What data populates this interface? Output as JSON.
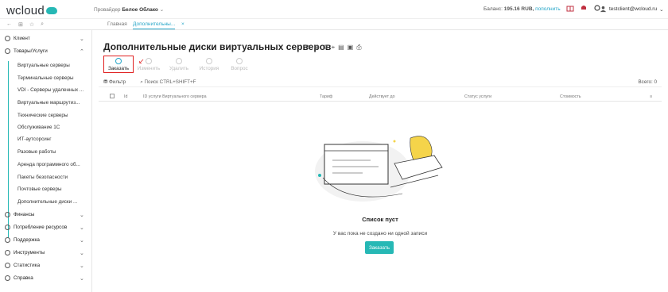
{
  "header": {
    "logo": "wcloud",
    "provider_label": "Провайдер",
    "provider_name": "Белое Облако",
    "balance_label": "Баланс:",
    "balance_value": "195.16 RUB,",
    "balance_link": "пополнить",
    "user": "testclient@wcloud.ru"
  },
  "tabs": [
    {
      "label": "Главная"
    },
    {
      "label": "Дополнительны..."
    }
  ],
  "sidebar": {
    "groups": [
      {
        "label": "Клиент"
      },
      {
        "label": "Товары/Услуги"
      },
      {
        "label": "Финансы"
      },
      {
        "label": "Потребление ресурсов"
      },
      {
        "label": "Поддержка"
      },
      {
        "label": "Инструменты"
      },
      {
        "label": "Статистика"
      },
      {
        "label": "Справка"
      }
    ],
    "items": [
      "Виртуальные серверы",
      "Терминальные серверы",
      "VDI - Серверы удаленных ...",
      "Виртуальные маршрутиз...",
      "Технические серверы",
      "Обслуживание 1С",
      "ИТ-аутсорсинг",
      "Разовые работы",
      "Аренда программного об...",
      "Пакеты безопасности",
      "Почтовые серверы",
      "Дополнительные диски ..."
    ]
  },
  "page": {
    "title": "Дополнительные диски виртуальных серверов",
    "toolbar": {
      "order": "Заказать",
      "edit": "Изменить",
      "delete": "Удалить",
      "history": "История",
      "question": "Вопрос"
    },
    "filter": "Фильтр",
    "search_placeholder": "Поиск CTRL+SHIFT+F",
    "total": "Всего: 0",
    "columns": [
      "Id",
      "ID услуги Виртуального сервера",
      "Тариф",
      "Действует до",
      "Статус услуги",
      "Стоимость"
    ],
    "empty_title": "Список пуст",
    "empty_subtitle": "У вас пока не создано ни одной записи",
    "empty_button": "Заказать"
  }
}
